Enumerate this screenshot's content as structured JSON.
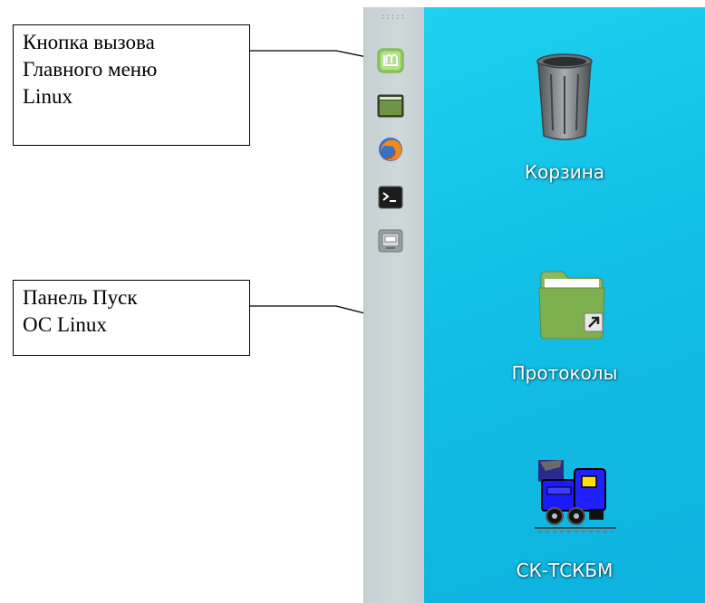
{
  "annotations": {
    "menu_button": {
      "lines": [
        "Кнопка вызова",
        "Главного меню",
        "Linux"
      ]
    },
    "start_panel": {
      "lines": [
        "Панель Пуск",
        "ОС Linux"
      ]
    }
  },
  "panel": {
    "launchers": [
      {
        "icon": "linux-mint-menu-icon"
      },
      {
        "icon": "show-desktop-icon"
      },
      {
        "icon": "firefox-icon"
      },
      {
        "icon": "terminal-icon"
      },
      {
        "icon": "virtual-machine-icon"
      }
    ]
  },
  "desktop": {
    "background": "#12bfe6",
    "icons": [
      {
        "icon": "trash-icon",
        "label": "Корзина"
      },
      {
        "icon": "folder-shortcut-icon",
        "label": "Протоколы"
      },
      {
        "icon": "locomotive-icon",
        "label": "СК-ТСКБМ"
      }
    ]
  }
}
